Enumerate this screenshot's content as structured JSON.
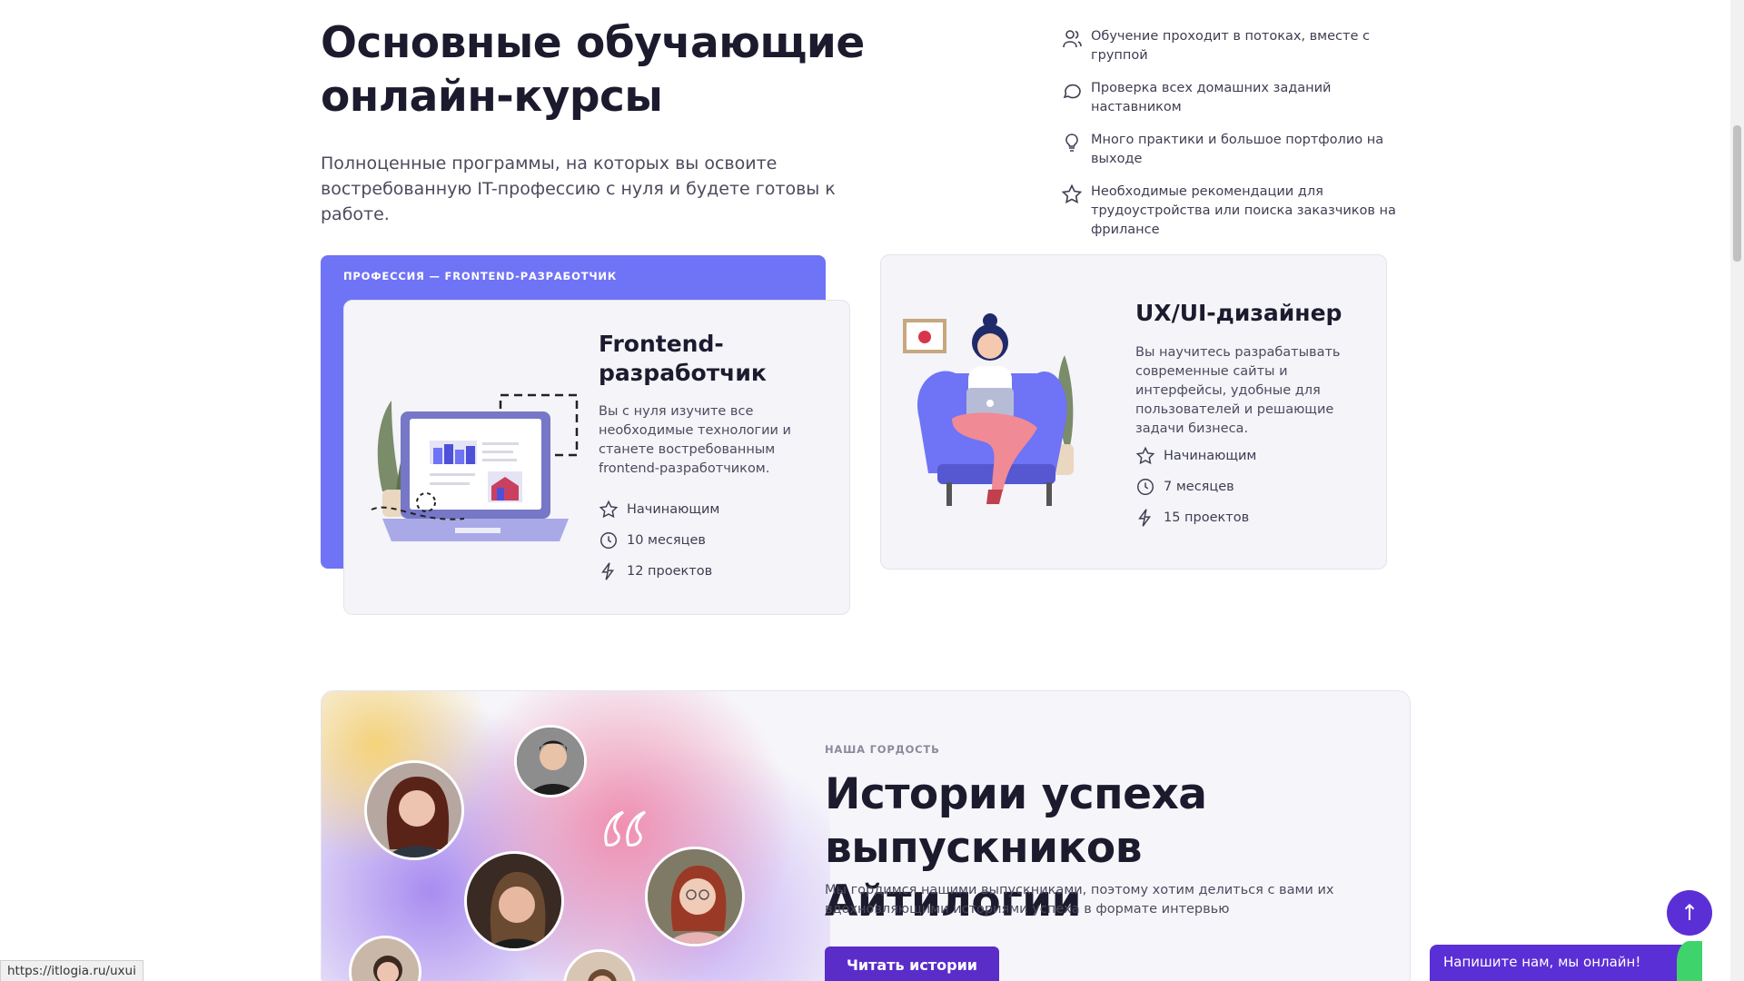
{
  "header": {
    "title": "Основные обучающие онлайн-курсы",
    "subtitle": "Полноценные программы, на которых вы освоите востребованную IT-профессию с нуля и будете готовы к работе."
  },
  "features": [
    {
      "icon": "group-icon",
      "text": "Обучение проходит в потоках, вместе с группой"
    },
    {
      "icon": "chat-bubble-icon",
      "text": "Проверка всех домашних заданий наставником"
    },
    {
      "icon": "lightbulb-icon",
      "text": "Много практики и большое портфолио на выходе"
    },
    {
      "icon": "star-icon",
      "text": "Необходимые рекомендации для трудоустройства или поиска заказчиков на фрилансе"
    }
  ],
  "courses": {
    "frontend": {
      "kicker": "ПРОФЕССИЯ — FRONTEND-РАЗРАБОТЧИК",
      "title": "Frontend-разработчик",
      "description": "Вы с нуля изучите все необходимые технологии и станете востребованным frontend-разработчиком.",
      "level": "Начинающим",
      "duration": "10 месяцев",
      "projects": "12 проектов"
    },
    "uxui": {
      "title": "UX/UI-дизайнер",
      "description": "Вы научитесь разрабатывать современные сайты и интерфейсы, удобные для пользователей и решающие задачи бизнеса.",
      "level": "Начинающим",
      "duration": "7 месяцев",
      "projects": "15 проектов"
    }
  },
  "success": {
    "kicker": "НАША ГОРДОСТЬ",
    "title": "Истории успеха выпускников Айтилогии",
    "subtitle": "Мы гордимся нашими выпускниками, поэтому хотим делиться с вами их вдохновляющими историями успеха в формате интервью",
    "button": "Читать истории"
  },
  "chat": {
    "label": "Напишите нам, мы онлайн!"
  },
  "scroll_top": {
    "icon": "arrow-up-icon",
    "glyph": "↑"
  },
  "status_url": "https://itlogia.ru/uxui",
  "colors": {
    "accent": "#6f73f5",
    "button": "#5a2dc9",
    "chat": "#5b2fd6",
    "online": "#3fd36b"
  }
}
